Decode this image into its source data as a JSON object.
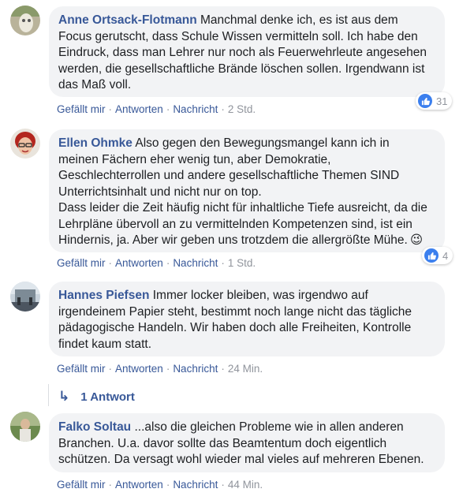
{
  "actions": {
    "like": "Gefällt mir",
    "reply": "Antworten",
    "message": "Nachricht",
    "sep": "·"
  },
  "comments": [
    {
      "author": "Anne Ortsack-Flotmann",
      "lines": [
        "Manchmal denke ich, es ist aus dem",
        "Focus gerutscht, dass Schule Wissen vermitteln soll. Ich habe den",
        "Eindruck, dass man Lehrer nur noch als Feuerwehrleute angesehen",
        "werden, die gesellschaftliche Brände löschen sollen. Irgendwann ist",
        "das Maß voll."
      ],
      "time": "2 Std.",
      "reactions": "31"
    },
    {
      "author": "Ellen Ohmke",
      "lines": [
        "Also gegen den Bewegungsmangel kann ich in",
        "meinen Fächern eher wenig tun, aber Demokratie,",
        "Geschlechterrollen und andere gesellschaftliche Themen SIND",
        "Unterrichtsinhalt und nicht nur on top.",
        "Dass leider die Zeit häufig nicht für inhaltliche Tiefe ausreicht, da die",
        "Lehrpläne übervoll an zu vermittelnden Kompetenzen sind, ist ein",
        "Hindernis, ja. Aber wir geben uns trotzdem die allergrößte Mühe."
      ],
      "time": "1 Std.",
      "reactions": "4",
      "emoji": "😉"
    },
    {
      "author": "Hannes Piefsen",
      "lines": [
        "Immer locker bleiben, was irgendwo auf",
        "irgendeinem Papier steht, bestimmt noch lange nicht das tägliche",
        "pädagogische Handeln. Wir haben doch alle Freiheiten, Kontrolle",
        "findet kaum statt."
      ],
      "time": "24 Min.",
      "replies": "1 Antwort"
    },
    {
      "author": "Falko Soltau",
      "lines": [
        "...also die gleichen Probleme wie in allen anderen",
        "Branchen. U.a. davor sollte das Beamtentum doch eigentlich",
        "schützen. Da versagt wohl wieder mal vieles auf mehreren Ebenen."
      ],
      "time": "44 Min."
    }
  ]
}
